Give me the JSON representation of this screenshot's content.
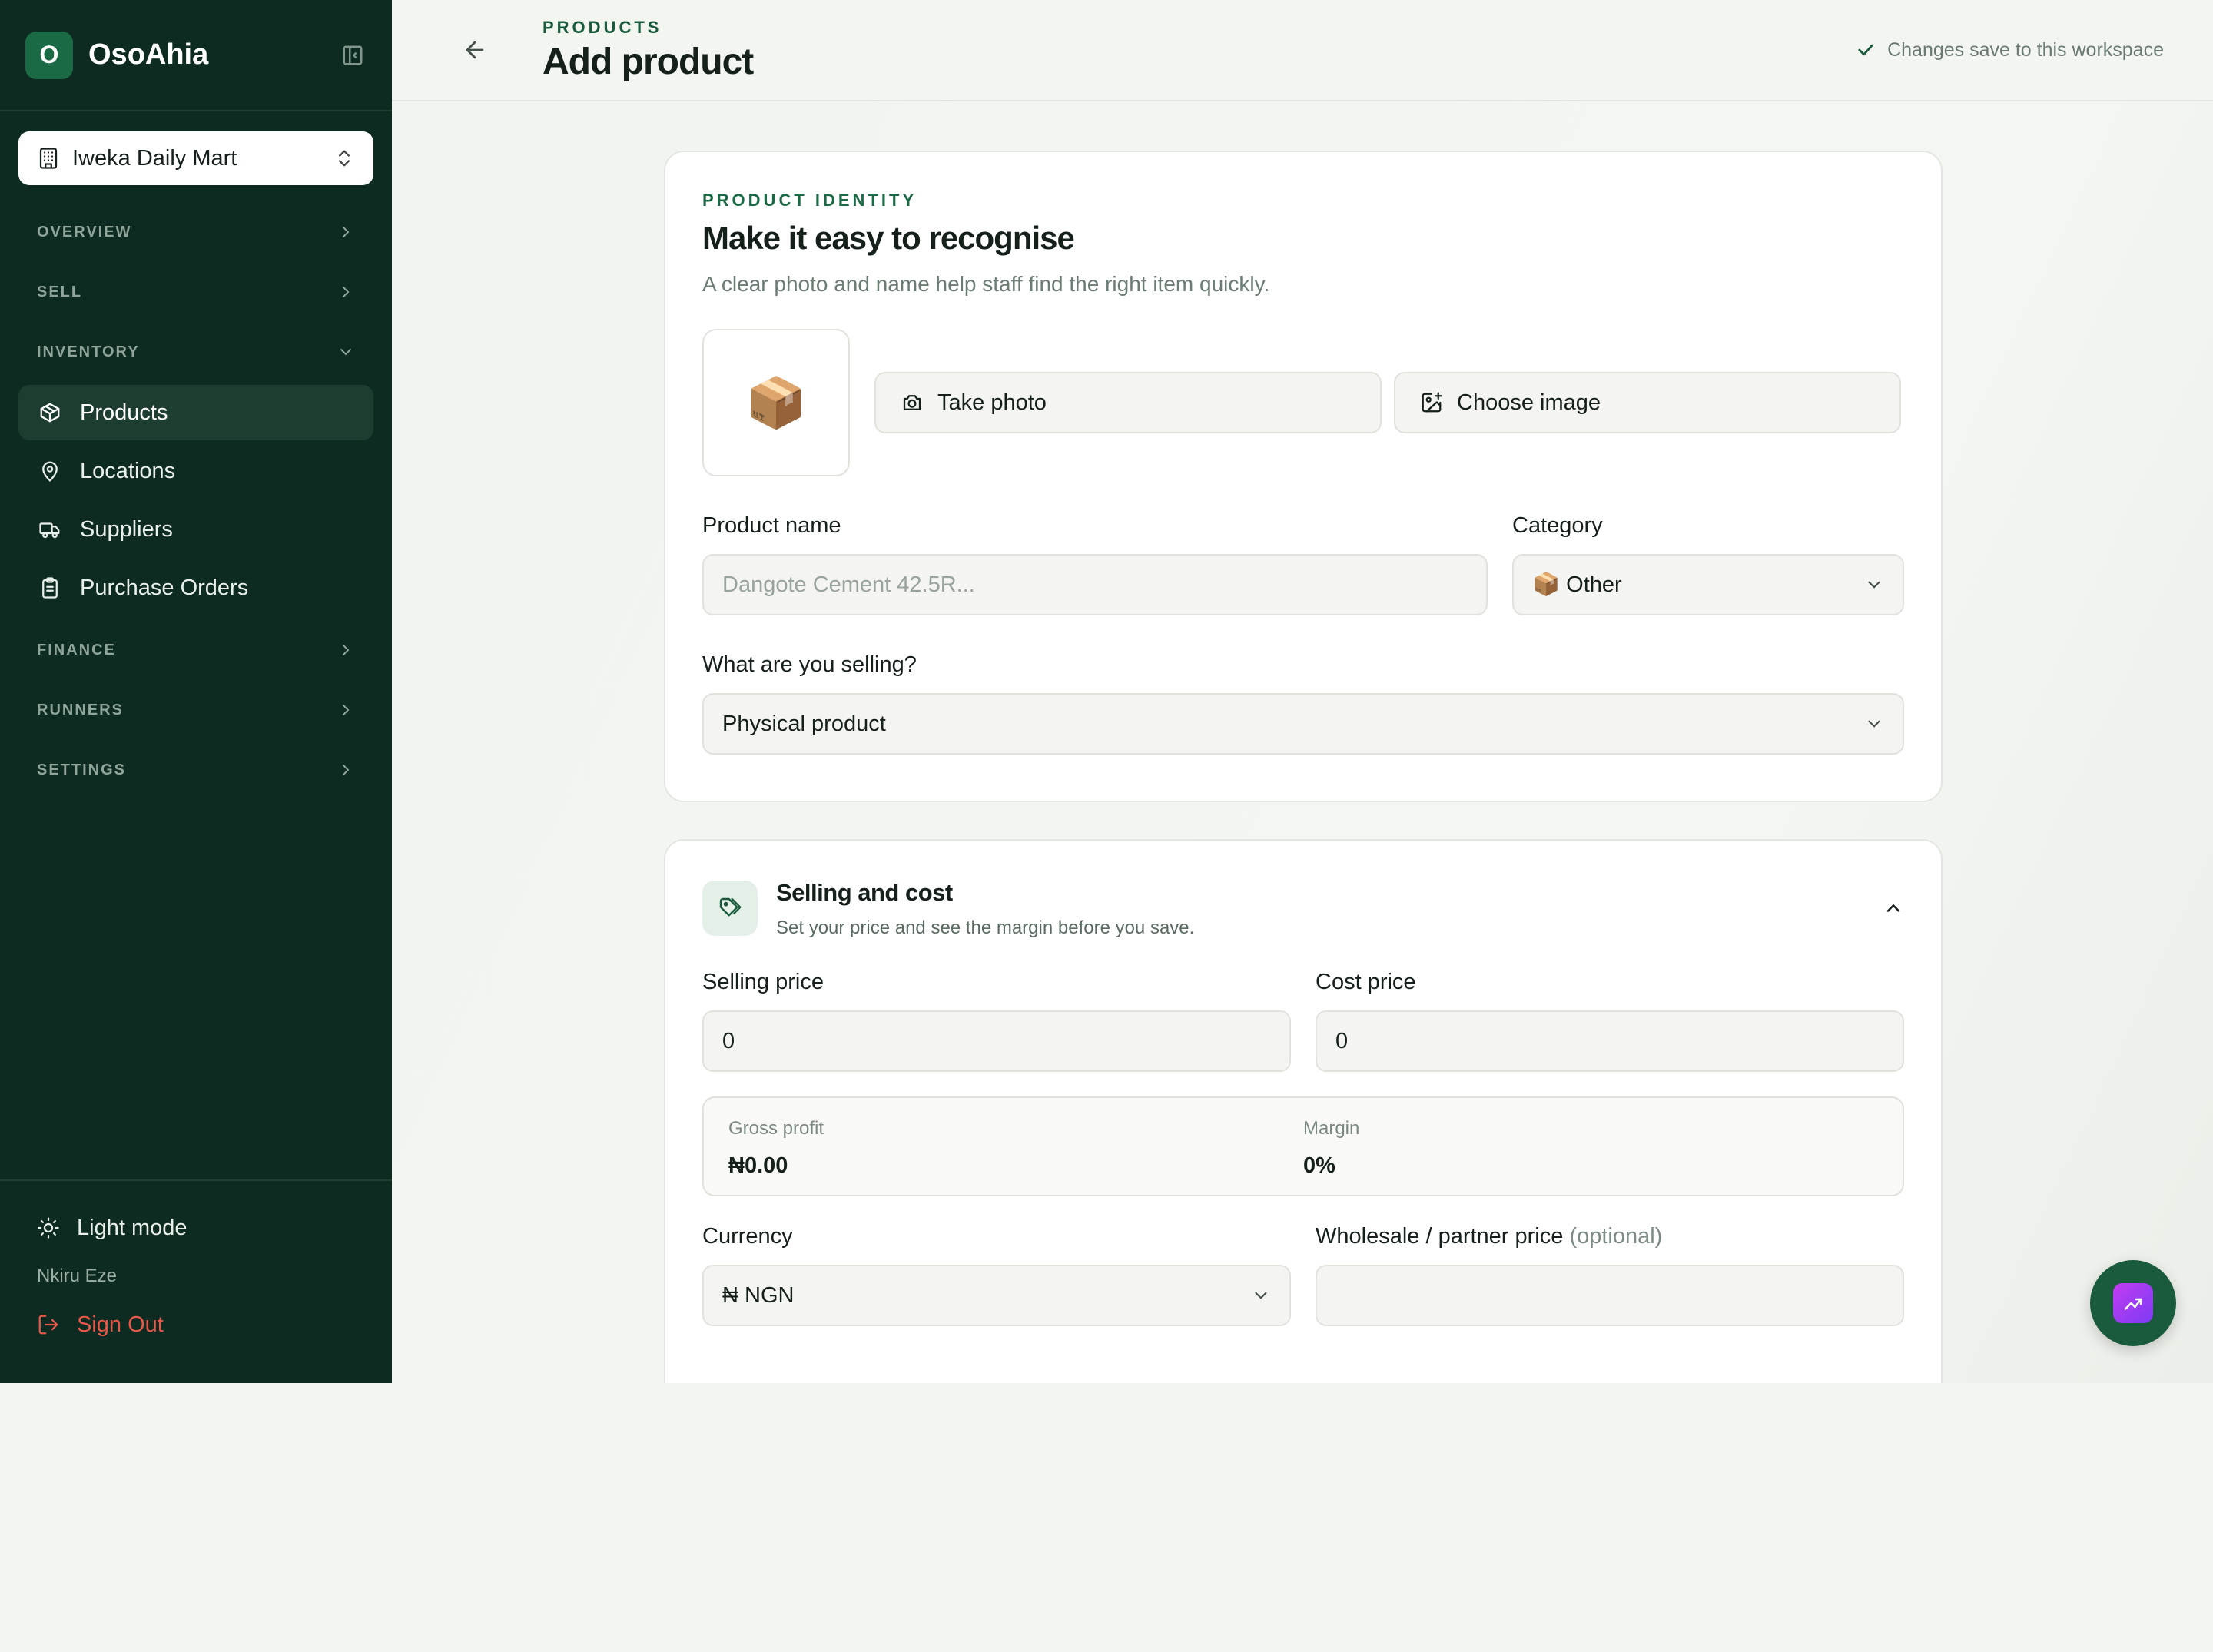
{
  "brand": {
    "logo_letter": "O",
    "name": "OsoAhia"
  },
  "workspace": {
    "name": "Iweka Daily Mart"
  },
  "nav": {
    "overview": "OVERVIEW",
    "sell": "SELL",
    "inventory": "INVENTORY",
    "items": [
      {
        "label": "Products",
        "icon": "box-icon",
        "active": true
      },
      {
        "label": "Locations",
        "icon": "map-pin-icon"
      },
      {
        "label": "Suppliers",
        "icon": "truck-icon"
      },
      {
        "label": "Purchase Orders",
        "icon": "clipboard-icon"
      }
    ],
    "finance": "FINANCE",
    "runners": "RUNNERS",
    "settings": "SETTINGS"
  },
  "footer": {
    "theme_label": "Light mode",
    "user_name": "Nkiru Eze",
    "signout_label": "Sign Out"
  },
  "header": {
    "breadcrumb": "PRODUCTS",
    "title": "Add product",
    "save_note": "Changes save to this workspace"
  },
  "identity": {
    "eyebrow": "PRODUCT IDENTITY",
    "title": "Make it easy to recognise",
    "subtitle": "A clear photo and name help staff find the right item quickly.",
    "thumb_emoji": "📦",
    "take_photo": "Take photo",
    "choose_image": "Choose image",
    "name_label": "Product name",
    "name_placeholder": "Dangote Cement 42.5R...",
    "category_label": "Category",
    "category_value": "📦 Other",
    "selling_label": "What are you selling?",
    "selling_value": "Physical product"
  },
  "pricing": {
    "title": "Selling and cost",
    "subtitle": "Set your price and see the margin before you save.",
    "selling_price_label": "Selling price",
    "selling_price_value": "0",
    "cost_price_label": "Cost price",
    "cost_price_value": "0",
    "gross_profit_label": "Gross profit",
    "gross_profit_value": "₦0.00",
    "margin_label": "Margin",
    "margin_value": "0%",
    "currency_label": "Currency",
    "currency_value": "₦ NGN",
    "wholesale_label": "Wholesale / partner price",
    "wholesale_optional": "(optional)",
    "wholesale_value": ""
  },
  "colors": {
    "sidebar": "#0d2b21",
    "accent": "#1a6b45",
    "danger": "#e8584a",
    "fab": "#1a5a3d"
  }
}
